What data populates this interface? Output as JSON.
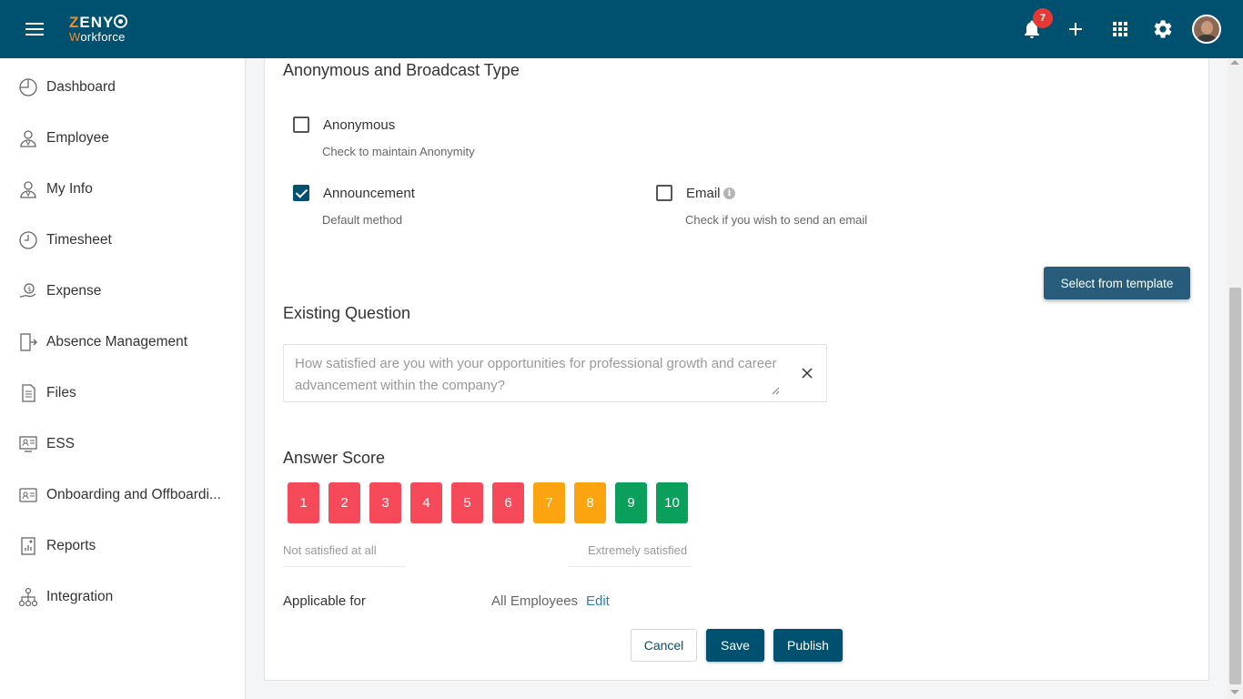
{
  "header": {
    "logo_brand_first": "Z",
    "logo_brand_rest": "ENY",
    "logo_sub_first": "W",
    "logo_sub_rest": "orkforce",
    "notification_count": "7",
    "bar_color": "#00506f"
  },
  "sidebar": {
    "items": [
      {
        "label": "Dashboard",
        "icon": "dashboard-icon"
      },
      {
        "label": "Employee",
        "icon": "employee-icon"
      },
      {
        "label": "My Info",
        "icon": "my-info-icon"
      },
      {
        "label": "Timesheet",
        "icon": "clock-icon"
      },
      {
        "label": "Expense",
        "icon": "expense-icon"
      },
      {
        "label": "Absence Management",
        "icon": "exit-door-icon"
      },
      {
        "label": "Files",
        "icon": "file-icon"
      },
      {
        "label": "ESS",
        "icon": "ess-icon"
      },
      {
        "label": "Onboarding and Offboardi...",
        "icon": "id-card-icon"
      },
      {
        "label": "Reports",
        "icon": "report-icon"
      },
      {
        "label": "Integration",
        "icon": "hierarchy-icon"
      }
    ]
  },
  "form": {
    "broadcast_title": "Anonymous and Broadcast Type",
    "anonymous": {
      "label": "Anonymous",
      "hint": "Check to maintain Anonymity",
      "checked": false
    },
    "announcement": {
      "label": "Announcement",
      "hint": "Default method",
      "checked": true
    },
    "email": {
      "label": "Email",
      "hint": "Check if you wish to send an email",
      "checked": false
    },
    "template_button": "Select from template",
    "existing_question_title": "Existing Question",
    "question_text": "How satisfied are you with your opportunities for professional growth and career advancement within the company?",
    "answer_score_title": "Answer Score",
    "scores": [
      {
        "value": "1",
        "color": "#f64a5a"
      },
      {
        "value": "2",
        "color": "#f64a5a"
      },
      {
        "value": "3",
        "color": "#f64a5a"
      },
      {
        "value": "4",
        "color": "#f64a5a"
      },
      {
        "value": "5",
        "color": "#f64a5a"
      },
      {
        "value": "6",
        "color": "#f64a5a"
      },
      {
        "value": "7",
        "color": "#fba40f"
      },
      {
        "value": "8",
        "color": "#fba40f"
      },
      {
        "value": "9",
        "color": "#0a9f5b"
      },
      {
        "value": "10",
        "color": "#0a9f5b"
      }
    ],
    "scale_low": "Not satisfied at all",
    "scale_high": "Extremely satisfied",
    "applicable_label": "Applicable for",
    "applicable_value": "All Employees",
    "edit_link": "Edit"
  },
  "actions": {
    "cancel": "Cancel",
    "save": "Save",
    "publish": "Publish"
  }
}
